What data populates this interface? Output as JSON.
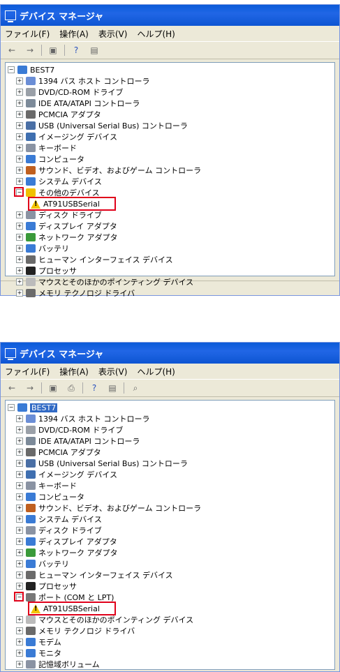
{
  "window1": {
    "title": "デバイス マネージャ",
    "menu": [
      "ファイル(F)",
      "操作(A)",
      "表示(V)",
      "ヘルプ(H)"
    ],
    "root": "BEST7",
    "items": [
      {
        "label": "1394 バス ホスト コントローラ",
        "icon": "#6b8ed6"
      },
      {
        "label": "DVD/CD-ROM ドライブ",
        "icon": "#9aa0a8"
      },
      {
        "label": "IDE ATA/ATAPI コントローラ",
        "icon": "#7c8a99"
      },
      {
        "label": "PCMCIA アダプタ",
        "icon": "#6a6a6a"
      },
      {
        "label": "USB (Universal Serial Bus) コントローラ",
        "icon": "#4a6fa5"
      },
      {
        "label": "イメージング デバイス",
        "icon": "#3f6fb0"
      },
      {
        "label": "キーボード",
        "icon": "#8a93a3"
      },
      {
        "label": "コンピュータ",
        "icon": "#3a7bd5"
      },
      {
        "label": "サウンド、ビデオ、およびゲーム コントローラ",
        "icon": "#c06020"
      },
      {
        "label": "システム デバイス",
        "icon": "#3a7bd5"
      },
      {
        "label": "その他のデバイス",
        "icon": "#f0c000"
      },
      {
        "label": "AT91USBSerial",
        "icon": "warning"
      },
      {
        "label": "ディスク ドライブ",
        "icon": "#8a93a3"
      },
      {
        "label": "ディスプレイ アダプタ",
        "icon": "#3a7bd5"
      },
      {
        "label": "ネットワーク アダプタ",
        "icon": "#3a9a3a"
      },
      {
        "label": "バッテリ",
        "icon": "#3a7bd5"
      },
      {
        "label": "ヒューマン インターフェイス デバイス",
        "icon": "#6a6a6a"
      },
      {
        "label": "プロセッサ",
        "icon": "#222222"
      },
      {
        "label": "マウスとそのほかのポインティング デバイス",
        "icon": "#bbbbbb"
      },
      {
        "label": "メモリ テクノロジ ドライバ",
        "icon": "#6a6a6a"
      }
    ]
  },
  "window2": {
    "title": "デバイス マネージャ",
    "menu": [
      "ファイル(F)",
      "操作(A)",
      "表示(V)",
      "ヘルプ(H)"
    ],
    "root": "BEST7",
    "items": [
      {
        "label": "1394 バス ホスト コントローラ",
        "icon": "#6b8ed6"
      },
      {
        "label": "DVD/CD-ROM ドライブ",
        "icon": "#9aa0a8"
      },
      {
        "label": "IDE ATA/ATAPI コントローラ",
        "icon": "#7c8a99"
      },
      {
        "label": "PCMCIA アダプタ",
        "icon": "#6a6a6a"
      },
      {
        "label": "USB (Universal Serial Bus) コントローラ",
        "icon": "#4a6fa5"
      },
      {
        "label": "イメージング デバイス",
        "icon": "#3f6fb0"
      },
      {
        "label": "キーボード",
        "icon": "#8a93a3"
      },
      {
        "label": "コンピュータ",
        "icon": "#3a7bd5"
      },
      {
        "label": "サウンド、ビデオ、およびゲーム コントローラ",
        "icon": "#c06020"
      },
      {
        "label": "システム デバイス",
        "icon": "#3a7bd5"
      },
      {
        "label": "ディスク ドライブ",
        "icon": "#8a93a3"
      },
      {
        "label": "ディスプレイ アダプタ",
        "icon": "#3a7bd5"
      },
      {
        "label": "ネットワーク アダプタ",
        "icon": "#3a9a3a"
      },
      {
        "label": "バッテリ",
        "icon": "#3a7bd5"
      },
      {
        "label": "ヒューマン インターフェイス デバイス",
        "icon": "#6a6a6a"
      },
      {
        "label": "プロセッサ",
        "icon": "#222222"
      },
      {
        "label": "ポート (COM と LPT)",
        "icon": "#777777"
      },
      {
        "label": "AT91USBSerial",
        "icon": "warning"
      },
      {
        "label": "マウスとそのほかのポインティング デバイス",
        "icon": "#bbbbbb"
      },
      {
        "label": "メモリ テクノロジ ドライバ",
        "icon": "#6a6a6a"
      },
      {
        "label": "モデム",
        "icon": "#3a7bd5"
      },
      {
        "label": "モニタ",
        "icon": "#3a7bd5"
      },
      {
        "label": "記憶域ボリューム",
        "icon": "#8a93a3"
      }
    ]
  }
}
